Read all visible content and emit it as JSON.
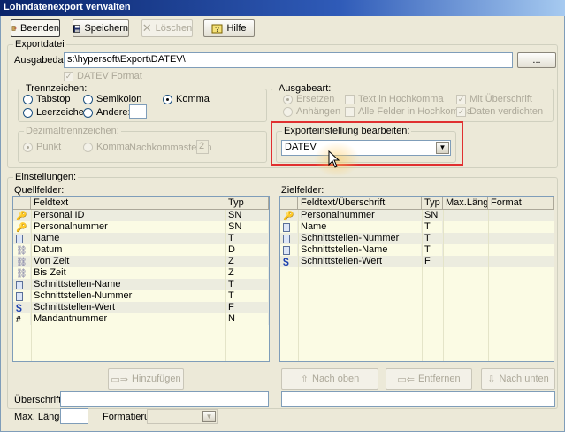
{
  "window": {
    "title": "Lohndatenexport verwalten"
  },
  "toolbar": {
    "beenden": "Beenden",
    "speichern": "Speichern",
    "loeschen": "Löschen",
    "hilfe": "Hilfe"
  },
  "exportdatei": {
    "legend": "Exportdatei",
    "ausgabedatei_label": "Ausgabedatei:",
    "ausgabedatei_value": "s:\\hypersoft\\Export\\DATEV\\",
    "browse_label": "...",
    "datev_format": "DATEV Format"
  },
  "trennzeichen": {
    "legend": "Trennzeichen:",
    "tabstop": "Tabstop",
    "semikolon": "Semikolon",
    "komma": "Komma",
    "leerzeichen": "Leerzeichen",
    "andere": "Andere:"
  },
  "ausgabeart": {
    "legend": "Ausgabeart:",
    "ersetzen": "Ersetzen",
    "anhaengen": "Anhängen",
    "text_hochkomma": "Text in Hochkomma",
    "alle_felder": "Alle Felder in Hochkomma",
    "mit_ueberschrift": "Mit Überschrift",
    "daten_verdichten": "Daten verdichten"
  },
  "dezimal": {
    "legend": "Dezimaltrennzeichen:",
    "punkt": "Punkt",
    "komma": "Komma",
    "nachkomma_label": "Nachkommastellen",
    "nachkomma_value": "2"
  },
  "exporteinstellung": {
    "legend": "Exporteinstellung bearbeiten:",
    "selected": "DATEV"
  },
  "einstellungen": {
    "legend": "Einstellungen:",
    "quellfelder_label": "Quellfelder:",
    "zielfelder_label": "Zielfelder:",
    "quell_headers": [
      "Feldtext",
      "Typ"
    ],
    "ziel_headers": [
      "Feldtext/Überschrift",
      "Typ",
      "Max.Länge",
      "Format"
    ],
    "quell_rows": [
      {
        "icon": "key-icon",
        "text": "Personal ID",
        "typ": "SN"
      },
      {
        "icon": "key-icon",
        "text": "Personalnummer",
        "typ": "SN"
      },
      {
        "icon": "document-icon",
        "text": "Name",
        "typ": "T"
      },
      {
        "icon": "link-icon",
        "text": "Datum",
        "typ": "D"
      },
      {
        "icon": "link-icon",
        "text": "Von Zeit",
        "typ": "Z"
      },
      {
        "icon": "link-icon",
        "text": "Bis Zeit",
        "typ": "Z"
      },
      {
        "icon": "document-icon",
        "text": "Schnittstellen-Name",
        "typ": "T"
      },
      {
        "icon": "document-icon",
        "text": "Schnittstellen-Nummer",
        "typ": "T"
      },
      {
        "icon": "dollar-icon",
        "text": "Schnittstellen-Wert",
        "typ": "F"
      },
      {
        "icon": "hash-icon",
        "text": "Mandantnummer",
        "typ": "N"
      }
    ],
    "ziel_rows": [
      {
        "icon": "key-icon",
        "text": "Personalnummer",
        "typ": "SN"
      },
      {
        "icon": "document-icon",
        "text": "Name",
        "typ": "T"
      },
      {
        "icon": "document-icon",
        "text": "Schnittstellen-Nummer",
        "typ": "T"
      },
      {
        "icon": "document-icon",
        "text": "Schnittstellen-Name",
        "typ": "T"
      },
      {
        "icon": "dollar-icon",
        "text": "Schnittstellen-Wert",
        "typ": "F"
      }
    ],
    "hinzufuegen": "Hinzufügen",
    "nach_oben": "Nach oben",
    "entfernen": "Entfernen",
    "nach_unten": "Nach unten",
    "ueberschrift_label": "Überschrift:",
    "max_laenge_label": "Max. Länge:",
    "formatierung_label": "Formatierung:"
  }
}
